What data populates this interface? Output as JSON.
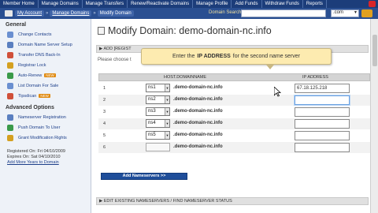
{
  "topnav": {
    "items": [
      "Member Home",
      "Manage Domains",
      "Manage Transfers",
      "Renew/Reactivate Domains",
      "Manage Profile",
      "Add Funds",
      "Withdraw Funds",
      "Reports"
    ]
  },
  "breadcrumb": {
    "items": [
      "My Account",
      "Manage Domains",
      "Modify Domain"
    ],
    "search_label": "Domain Search: www.",
    "search_value": "",
    "tld_value": ".com"
  },
  "sidebar": {
    "general_title": "General",
    "general_items": [
      {
        "label": "Change Contacts",
        "icon": "contacts-icon",
        "color": "#6a8fd0"
      },
      {
        "label": "Domain Name Server Setup",
        "icon": "server-icon",
        "color": "#5a7fc0"
      },
      {
        "label": "Transfer DNS Back-In",
        "icon": "transfer-icon",
        "color": "#d0503a"
      },
      {
        "label": "Registrar Lock",
        "icon": "lock-icon",
        "color": "#d4a020"
      },
      {
        "label": "Auto-Renew",
        "icon": "renew-icon",
        "color": "#3a9a4a",
        "badge": "NEW"
      },
      {
        "label": "List Domain For Sale",
        "icon": "sale-icon",
        "color": "#6a8fd0"
      },
      {
        "label": "Tipsdican",
        "icon": "tip-icon",
        "color": "#d0503a",
        "badge": "NEW"
      }
    ],
    "advanced_title": "Advanced Options",
    "advanced_items": [
      {
        "label": "Nameserver Registration",
        "icon": "nameserver-icon",
        "color": "#5a7fc0"
      },
      {
        "label": "Push Domain To User",
        "icon": "push-icon",
        "color": "#3a9a4a"
      },
      {
        "label": "Grant Modification Rights",
        "icon": "grant-icon",
        "color": "#d4a020"
      }
    ],
    "registered": "Registered On: Fri 04/10/2009",
    "expires": "Expires On: Sat 04/10/2010",
    "add_years": "Add More Years to Domain"
  },
  "main": {
    "title": "Modify Domain: demo-domain-nc.info",
    "section_label": "ADD [REGIST",
    "instruction": "Please choose t",
    "tooltip_before": "Enter the",
    "tooltip_ip": "IP ADDRESS",
    "tooltip_after": "for the second name server",
    "col_host": "HOST.DOMAINNAME",
    "col_ip": "IP ADDRESS",
    "rows": [
      {
        "num": "1",
        "ns": "ns1",
        "domain": ".demo-domain-nc.info",
        "ip": "67.18.125.218"
      },
      {
        "num": "2",
        "ns": "ns2",
        "domain": ".demo-domain-nc.info",
        "ip": ""
      },
      {
        "num": "3",
        "ns": "ns3",
        "domain": ".demo-domain-nc.info",
        "ip": ""
      },
      {
        "num": "4",
        "ns": "ns4",
        "domain": ".demo-domain-nc.info",
        "ip": ""
      },
      {
        "num": "5",
        "ns": "ns5",
        "domain": ".demo-domain-nc.info",
        "ip": ""
      },
      {
        "num": "6",
        "ns": "",
        "domain": ".demo-domain-nc.info",
        "ip": ""
      }
    ],
    "add_button": "Add Nameservers >>",
    "existing_label": "EDIT EXISTING NAMESERVERS / FIND NAMESERVER STATUS"
  },
  "colors": {
    "nav": "#1c3d7a",
    "crumb": "#2a4f91",
    "tooltip": "#fdebb0",
    "button": "#1f4e9a"
  }
}
